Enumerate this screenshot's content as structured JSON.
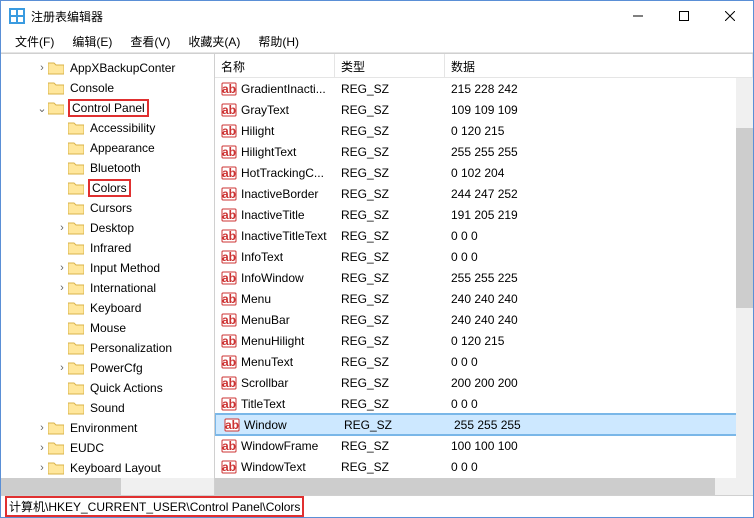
{
  "window": {
    "title": "注册表编辑器"
  },
  "menu": {
    "file": "文件(F)",
    "edit": "编辑(E)",
    "view": "查看(V)",
    "favorites": "收藏夹(A)",
    "help": "帮助(H)"
  },
  "tree": [
    {
      "ind": 35,
      "chev": ">",
      "label": "AppXBackupConter"
    },
    {
      "ind": 35,
      "chev": "",
      "label": "Console"
    },
    {
      "ind": 35,
      "chev": "v",
      "label": "Control Panel",
      "hl": "red"
    },
    {
      "ind": 55,
      "chev": "",
      "label": "Accessibility"
    },
    {
      "ind": 55,
      "chev": "",
      "label": "Appearance"
    },
    {
      "ind": 55,
      "chev": "",
      "label": "Bluetooth"
    },
    {
      "ind": 55,
      "chev": "",
      "label": "Colors",
      "hl": "red"
    },
    {
      "ind": 55,
      "chev": "",
      "label": "Cursors"
    },
    {
      "ind": 55,
      "chev": ">",
      "label": "Desktop"
    },
    {
      "ind": 55,
      "chev": "",
      "label": "Infrared"
    },
    {
      "ind": 55,
      "chev": ">",
      "label": "Input Method"
    },
    {
      "ind": 55,
      "chev": ">",
      "label": "International"
    },
    {
      "ind": 55,
      "chev": "",
      "label": "Keyboard"
    },
    {
      "ind": 55,
      "chev": "",
      "label": "Mouse"
    },
    {
      "ind": 55,
      "chev": "",
      "label": "Personalization"
    },
    {
      "ind": 55,
      "chev": ">",
      "label": "PowerCfg"
    },
    {
      "ind": 55,
      "chev": "",
      "label": "Quick Actions"
    },
    {
      "ind": 55,
      "chev": "",
      "label": "Sound"
    },
    {
      "ind": 35,
      "chev": ">",
      "label": "Environment"
    },
    {
      "ind": 35,
      "chev": ">",
      "label": "EUDC"
    },
    {
      "ind": 35,
      "chev": ">",
      "label": "Keyboard Layout"
    }
  ],
  "cols": {
    "name": "名称",
    "type": "类型",
    "data": "数据"
  },
  "rows": [
    {
      "name": "GradientInacti...",
      "type": "REG_SZ",
      "data": "215 228 242"
    },
    {
      "name": "GrayText",
      "type": "REG_SZ",
      "data": "109 109 109"
    },
    {
      "name": "Hilight",
      "type": "REG_SZ",
      "data": "0 120 215"
    },
    {
      "name": "HilightText",
      "type": "REG_SZ",
      "data": "255 255 255"
    },
    {
      "name": "HotTrackingC...",
      "type": "REG_SZ",
      "data": "0 102 204"
    },
    {
      "name": "InactiveBorder",
      "type": "REG_SZ",
      "data": "244 247 252"
    },
    {
      "name": "InactiveTitle",
      "type": "REG_SZ",
      "data": "191 205 219"
    },
    {
      "name": "InactiveTitleText",
      "type": "REG_SZ",
      "data": "0 0 0"
    },
    {
      "name": "InfoText",
      "type": "REG_SZ",
      "data": "0 0 0"
    },
    {
      "name": "InfoWindow",
      "type": "REG_SZ",
      "data": "255 255 225"
    },
    {
      "name": "Menu",
      "type": "REG_SZ",
      "data": "240 240 240"
    },
    {
      "name": "MenuBar",
      "type": "REG_SZ",
      "data": "240 240 240"
    },
    {
      "name": "MenuHilight",
      "type": "REG_SZ",
      "data": "0 120 215"
    },
    {
      "name": "MenuText",
      "type": "REG_SZ",
      "data": "0 0 0"
    },
    {
      "name": "Scrollbar",
      "type": "REG_SZ",
      "data": "200 200 200"
    },
    {
      "name": "TitleText",
      "type": "REG_SZ",
      "data": "0 0 0"
    },
    {
      "name": "Window",
      "type": "REG_SZ",
      "data": "255 255 255",
      "sel": true
    },
    {
      "name": "WindowFrame",
      "type": "REG_SZ",
      "data": "100 100 100"
    },
    {
      "name": "WindowText",
      "type": "REG_SZ",
      "data": "0 0 0"
    }
  ],
  "status": {
    "path": "计算机\\HKEY_CURRENT_USER\\Control Panel\\Colors"
  }
}
